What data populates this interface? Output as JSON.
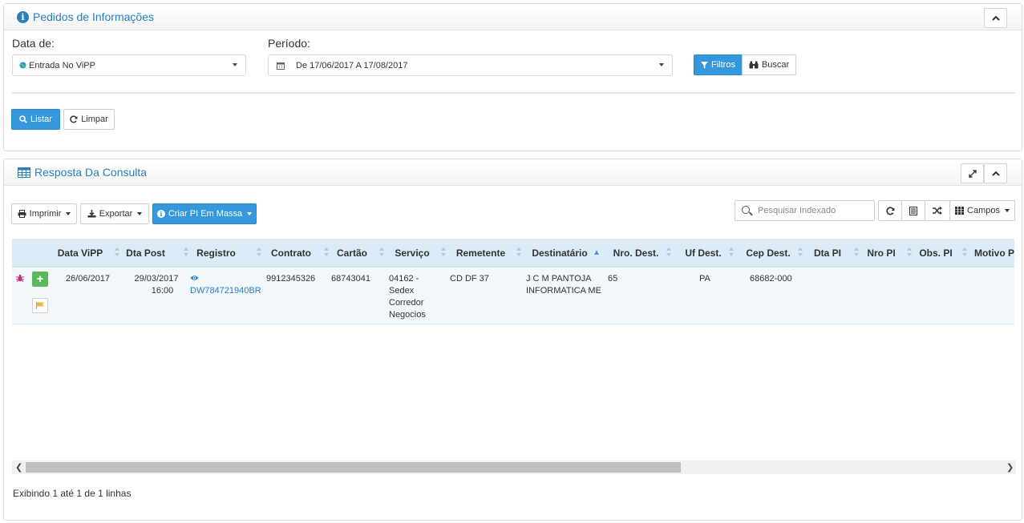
{
  "filters_panel": {
    "title": "Pedidos de Informações",
    "collapse_icon": "chevron-up-icon",
    "date_label": "Data de:",
    "date_select_value": "Entrada No ViPP",
    "period_label": "Período:",
    "period_value": "De 17/06/2017 A 17/08/2017",
    "filtros_label": "Filtros",
    "buscar_label": "Buscar",
    "listar_label": "Listar",
    "limpar_label": "Limpar"
  },
  "results_panel": {
    "title": "Resposta Da Consulta",
    "imprimir_label": "Imprimir",
    "exportar_label": "Exportar",
    "criar_label": "Criar PI Em Massa",
    "search_placeholder": "Pesquisar Indexado",
    "campos_label": "Campos",
    "columns": [
      "Data ViPP",
      "Dta Post",
      "Registro",
      "Contrato",
      "Cartão",
      "Serviço",
      "Remetente",
      "Destinatário",
      "Nro. Dest.",
      "Uf Dest.",
      "Cep Dest.",
      "Dta PI",
      "Nro PI",
      "Obs. PI",
      "Motivo P"
    ],
    "rows": [
      {
        "data_vipp": "26/06/2017",
        "dta_post_date": "29/03/2017",
        "dta_post_time": "16:00",
        "registro": "DW784721940BR",
        "contrato": "9912345326",
        "cartao": "68743041",
        "servico_lines": [
          "04162 -",
          "Sedex",
          "Corredor",
          "Negocios"
        ],
        "remetente": "CD DF 37",
        "destinatario_lines": [
          "J C M PANTOJA",
          "INFORMATICA ME"
        ],
        "nro_dest": "65",
        "uf_dest": "PA",
        "cep_dest": "68682-000"
      }
    ],
    "footer": "Exibindo 1 até 1 de 1 linhas"
  },
  "colors": {
    "primary": "#3598dc",
    "title_blue": "#2a7fb8",
    "header_bg": "#d9ecf7",
    "row_bg": "#f2f7fb",
    "add_green": "#5cb85c"
  }
}
